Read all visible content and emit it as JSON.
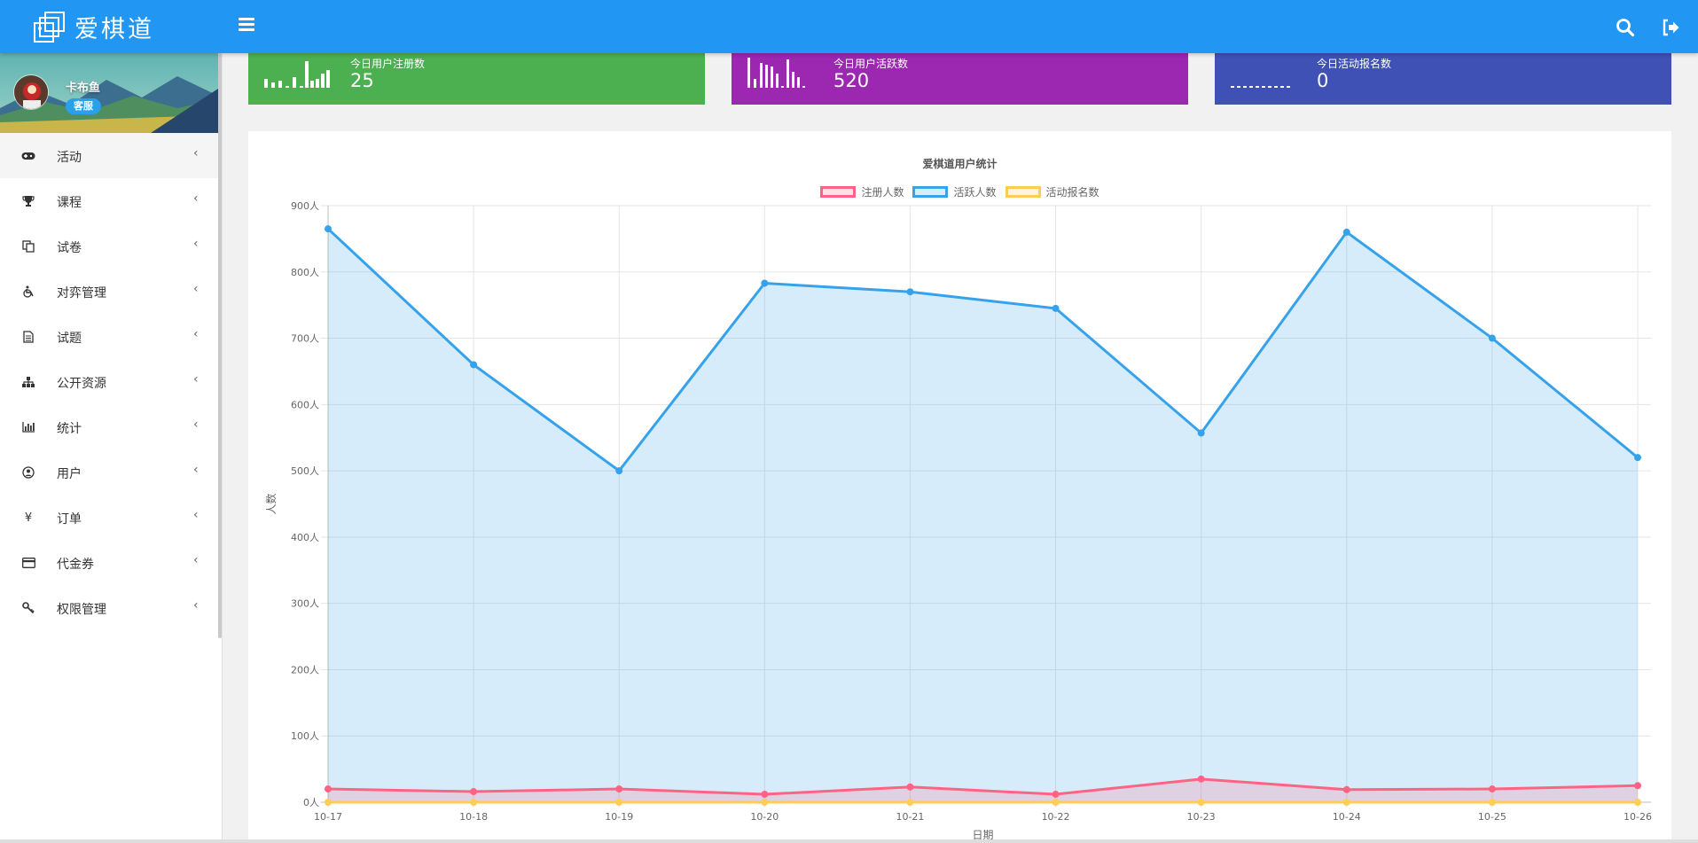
{
  "app": {
    "brand": "爱棋道"
  },
  "user": {
    "name": "卡布鱼",
    "role": "客服"
  },
  "sidebar": {
    "items": [
      {
        "label": "活动",
        "icon": "gamepad-icon"
      },
      {
        "label": "课程",
        "icon": "trophy-icon"
      },
      {
        "label": "试卷",
        "icon": "copy-icon"
      },
      {
        "label": "对弈管理",
        "icon": "wheelchair-icon"
      },
      {
        "label": "试题",
        "icon": "file-text-icon"
      },
      {
        "label": "公开资源",
        "icon": "sitemap-icon"
      },
      {
        "label": "统计",
        "icon": "bar-chart-icon"
      },
      {
        "label": "用户",
        "icon": "user-circle-icon"
      },
      {
        "label": "订单",
        "icon": "yen-icon"
      },
      {
        "label": "代金券",
        "icon": "credit-card-icon"
      },
      {
        "label": "权限管理",
        "icon": "key-icon"
      }
    ]
  },
  "cards": [
    {
      "title": "今日用户注册数",
      "value": "25",
      "color": "#4caf50"
    },
    {
      "title": "今日用户活跃数",
      "value": "520",
      "color": "#9c27b0"
    },
    {
      "title": "今日活动报名数",
      "value": "0",
      "color": "#3f51b5"
    }
  ],
  "chart_data": {
    "type": "line",
    "title": "爱棋道用户统计",
    "xlabel": "日期",
    "ylabel": "人数",
    "x": [
      "10-17",
      "10-18",
      "10-19",
      "10-20",
      "10-21",
      "10-22",
      "10-23",
      "10-24",
      "10-25",
      "10-26"
    ],
    "ylim": [
      0,
      900
    ],
    "yticks": [
      "0人",
      "100人",
      "200人",
      "300人",
      "400人",
      "500人",
      "600人",
      "700人",
      "800人",
      "900人"
    ],
    "grid": true,
    "legend_position": "top",
    "series": [
      {
        "name": "注册人数",
        "color": "#ff6384",
        "values": [
          20,
          16,
          20,
          12,
          23,
          12,
          35,
          19,
          20,
          25
        ]
      },
      {
        "name": "活跃人数",
        "color": "#36a2eb",
        "values": [
          865,
          660,
          500,
          783,
          770,
          745,
          557,
          860,
          700,
          520
        ]
      },
      {
        "name": "活动报名数",
        "color": "#ffcd56",
        "values": [
          0,
          0,
          0,
          0,
          0,
          0,
          0,
          0,
          0,
          0
        ]
      }
    ]
  }
}
